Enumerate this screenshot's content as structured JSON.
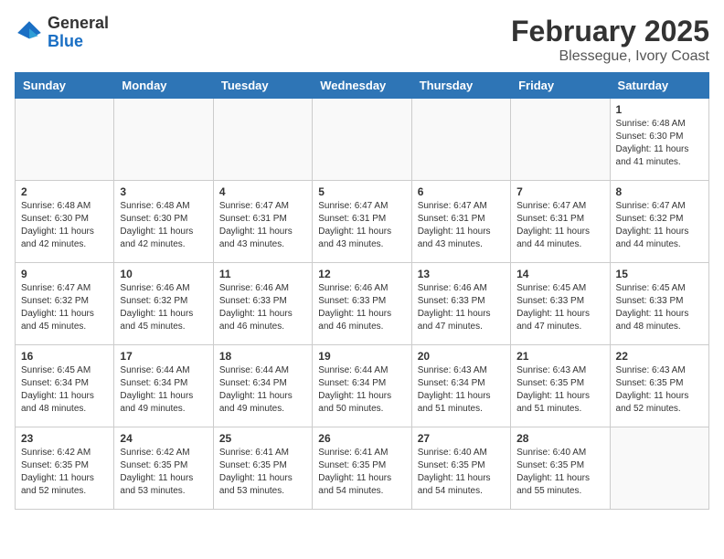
{
  "header": {
    "logo_general": "General",
    "logo_blue": "Blue",
    "month": "February 2025",
    "location": "Blessegue, Ivory Coast"
  },
  "days_of_week": [
    "Sunday",
    "Monday",
    "Tuesday",
    "Wednesday",
    "Thursday",
    "Friday",
    "Saturday"
  ],
  "weeks": [
    [
      {
        "day": "",
        "info": ""
      },
      {
        "day": "",
        "info": ""
      },
      {
        "day": "",
        "info": ""
      },
      {
        "day": "",
        "info": ""
      },
      {
        "day": "",
        "info": ""
      },
      {
        "day": "",
        "info": ""
      },
      {
        "day": "1",
        "info": "Sunrise: 6:48 AM\nSunset: 6:30 PM\nDaylight: 11 hours\nand 41 minutes."
      }
    ],
    [
      {
        "day": "2",
        "info": "Sunrise: 6:48 AM\nSunset: 6:30 PM\nDaylight: 11 hours\nand 42 minutes."
      },
      {
        "day": "3",
        "info": "Sunrise: 6:48 AM\nSunset: 6:30 PM\nDaylight: 11 hours\nand 42 minutes."
      },
      {
        "day": "4",
        "info": "Sunrise: 6:47 AM\nSunset: 6:31 PM\nDaylight: 11 hours\nand 43 minutes."
      },
      {
        "day": "5",
        "info": "Sunrise: 6:47 AM\nSunset: 6:31 PM\nDaylight: 11 hours\nand 43 minutes."
      },
      {
        "day": "6",
        "info": "Sunrise: 6:47 AM\nSunset: 6:31 PM\nDaylight: 11 hours\nand 43 minutes."
      },
      {
        "day": "7",
        "info": "Sunrise: 6:47 AM\nSunset: 6:31 PM\nDaylight: 11 hours\nand 44 minutes."
      },
      {
        "day": "8",
        "info": "Sunrise: 6:47 AM\nSunset: 6:32 PM\nDaylight: 11 hours\nand 44 minutes."
      }
    ],
    [
      {
        "day": "9",
        "info": "Sunrise: 6:47 AM\nSunset: 6:32 PM\nDaylight: 11 hours\nand 45 minutes."
      },
      {
        "day": "10",
        "info": "Sunrise: 6:46 AM\nSunset: 6:32 PM\nDaylight: 11 hours\nand 45 minutes."
      },
      {
        "day": "11",
        "info": "Sunrise: 6:46 AM\nSunset: 6:33 PM\nDaylight: 11 hours\nand 46 minutes."
      },
      {
        "day": "12",
        "info": "Sunrise: 6:46 AM\nSunset: 6:33 PM\nDaylight: 11 hours\nand 46 minutes."
      },
      {
        "day": "13",
        "info": "Sunrise: 6:46 AM\nSunset: 6:33 PM\nDaylight: 11 hours\nand 47 minutes."
      },
      {
        "day": "14",
        "info": "Sunrise: 6:45 AM\nSunset: 6:33 PM\nDaylight: 11 hours\nand 47 minutes."
      },
      {
        "day": "15",
        "info": "Sunrise: 6:45 AM\nSunset: 6:33 PM\nDaylight: 11 hours\nand 48 minutes."
      }
    ],
    [
      {
        "day": "16",
        "info": "Sunrise: 6:45 AM\nSunset: 6:34 PM\nDaylight: 11 hours\nand 48 minutes."
      },
      {
        "day": "17",
        "info": "Sunrise: 6:44 AM\nSunset: 6:34 PM\nDaylight: 11 hours\nand 49 minutes."
      },
      {
        "day": "18",
        "info": "Sunrise: 6:44 AM\nSunset: 6:34 PM\nDaylight: 11 hours\nand 49 minutes."
      },
      {
        "day": "19",
        "info": "Sunrise: 6:44 AM\nSunset: 6:34 PM\nDaylight: 11 hours\nand 50 minutes."
      },
      {
        "day": "20",
        "info": "Sunrise: 6:43 AM\nSunset: 6:34 PM\nDaylight: 11 hours\nand 51 minutes."
      },
      {
        "day": "21",
        "info": "Sunrise: 6:43 AM\nSunset: 6:35 PM\nDaylight: 11 hours\nand 51 minutes."
      },
      {
        "day": "22",
        "info": "Sunrise: 6:43 AM\nSunset: 6:35 PM\nDaylight: 11 hours\nand 52 minutes."
      }
    ],
    [
      {
        "day": "23",
        "info": "Sunrise: 6:42 AM\nSunset: 6:35 PM\nDaylight: 11 hours\nand 52 minutes."
      },
      {
        "day": "24",
        "info": "Sunrise: 6:42 AM\nSunset: 6:35 PM\nDaylight: 11 hours\nand 53 minutes."
      },
      {
        "day": "25",
        "info": "Sunrise: 6:41 AM\nSunset: 6:35 PM\nDaylight: 11 hours\nand 53 minutes."
      },
      {
        "day": "26",
        "info": "Sunrise: 6:41 AM\nSunset: 6:35 PM\nDaylight: 11 hours\nand 54 minutes."
      },
      {
        "day": "27",
        "info": "Sunrise: 6:40 AM\nSunset: 6:35 PM\nDaylight: 11 hours\nand 54 minutes."
      },
      {
        "day": "28",
        "info": "Sunrise: 6:40 AM\nSunset: 6:35 PM\nDaylight: 11 hours\nand 55 minutes."
      },
      {
        "day": "",
        "info": ""
      }
    ]
  ]
}
